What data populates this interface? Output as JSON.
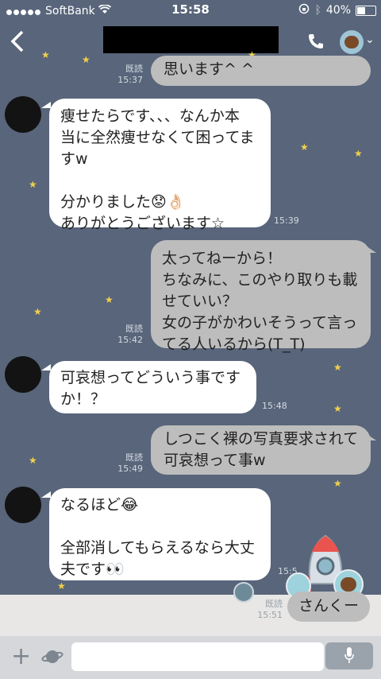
{
  "status": {
    "carrier": "SoftBank",
    "time": "15:58",
    "battery": "40%"
  },
  "header": {
    "title_redacted": true
  },
  "messages": [
    {
      "id": "m0",
      "side": "out",
      "text": "思います^ ^",
      "read": "既読",
      "time": "15:37"
    },
    {
      "id": "m1",
      "side": "in",
      "text": "痩せたらです、、、なんか本\n当に全然痩せなくて困ってま\nすw\n\n分かりました😟👌🏻\nありがとうございます☆",
      "time": "15:39"
    },
    {
      "id": "m2",
      "side": "out",
      "text": "太ってねーから！\nちなみに、このやり取りも載\nせていい？\n女の子がかわいそうって言っ\nてる人いるから(T_T)",
      "read": "既読",
      "time": "15:42"
    },
    {
      "id": "m3",
      "side": "in",
      "text": "可哀想ってどういう事です\nか！？",
      "time": "15:48"
    },
    {
      "id": "m4",
      "side": "out",
      "text": "しつこく裸の写真要求されて\n可哀想って事w",
      "read": "既読",
      "time": "15:49"
    },
    {
      "id": "m5",
      "side": "in",
      "text": "なるほど😂\n\n全部消してもらえるなら大丈\n夫です👀",
      "time": "15:5"
    },
    {
      "id": "m6",
      "side": "out",
      "text": "さんくー",
      "read": "既読",
      "time": "15:51"
    }
  ],
  "input": {
    "placeholder": ""
  },
  "icons": {
    "back": "chevron-left-icon",
    "phone": "phone-icon",
    "plus": "plus-icon",
    "planet": "planet-icon",
    "mic": "mic-icon"
  }
}
